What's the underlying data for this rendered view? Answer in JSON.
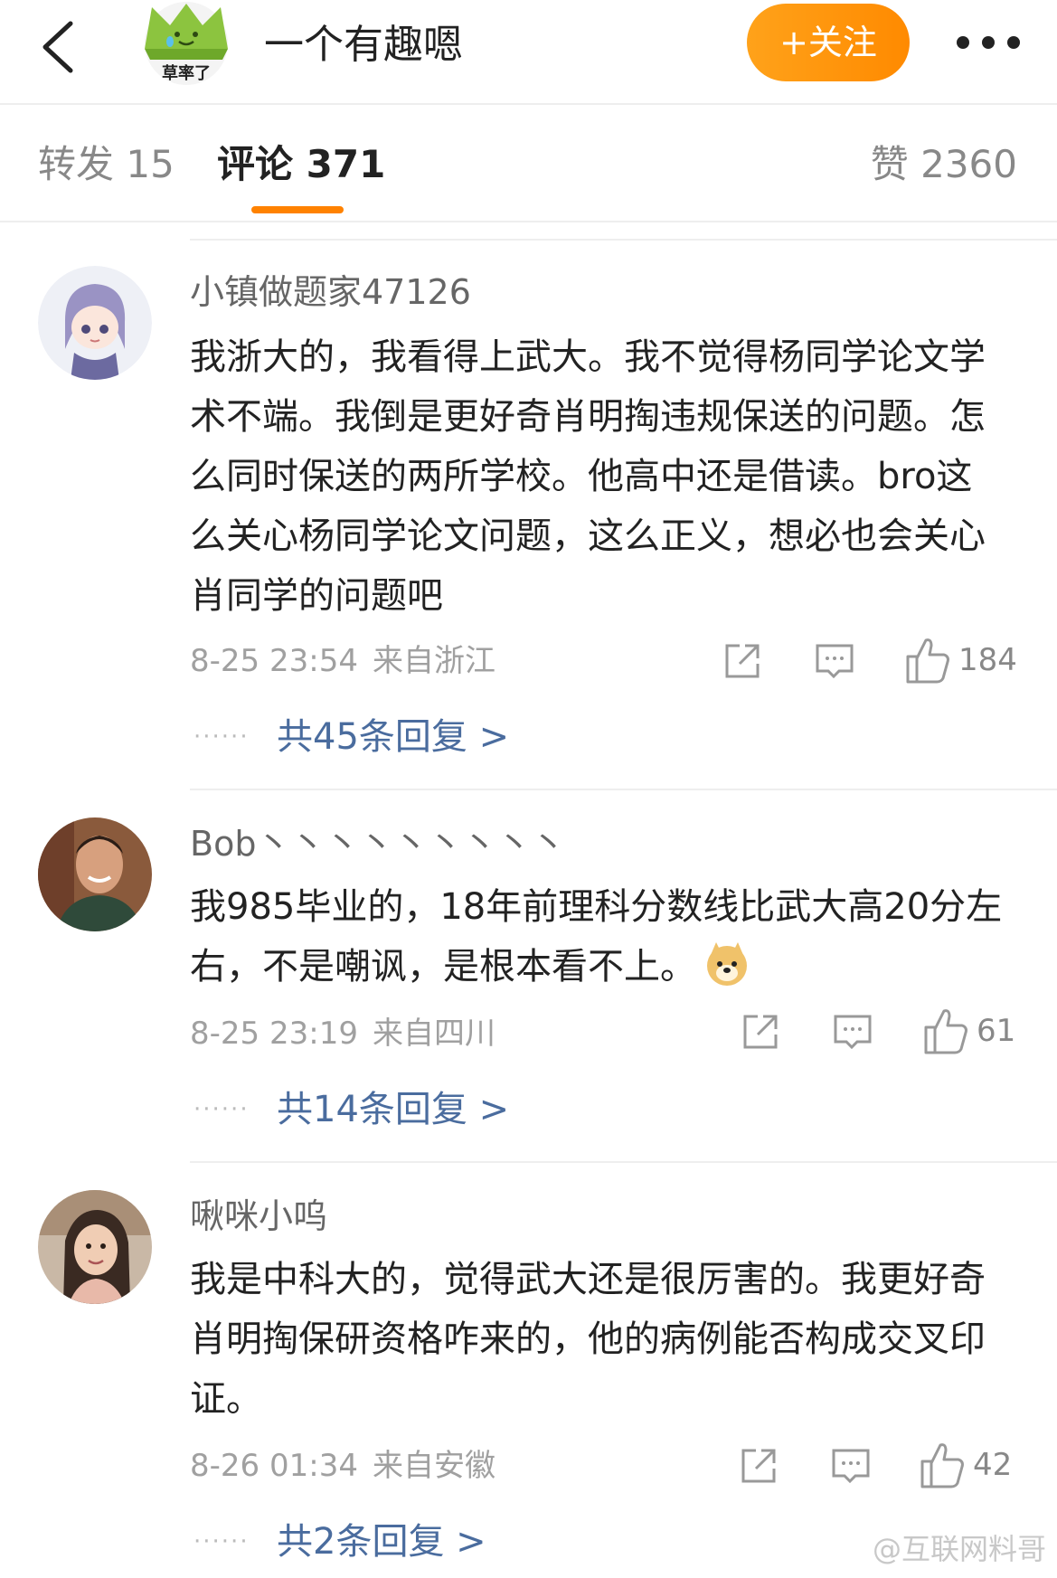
{
  "header": {
    "title": "一个有趣嗯",
    "avatar_caption": "草率了",
    "follow_label": "+关注"
  },
  "tabs": {
    "repost": "转发 15",
    "comments": "评论 371",
    "likes": "赞 2360"
  },
  "comments": [
    {
      "username": "小镇做题家47126",
      "content": "我浙大的，我看得上武大。我不觉得杨同学论文学术不端。我倒是更好奇肖明掏违规保送的问题。怎么同时保送的两所学校。他高中还是借读。bro这么关心杨同学论文问题，这么正义，想必也会关心肖同学的问题吧",
      "time": "8-25 23:54",
      "location": "来自浙江",
      "likes": "184",
      "replies": "共45条回复 >"
    },
    {
      "username": "Bob丶丶丶丶丶丶丶丶丶",
      "content": "我985毕业的，18年前理科分数线比武大高20分左右，不是嘲讽，是根本看不上。",
      "emoji": "doge",
      "time": "8-25 23:19",
      "location": "来自四川",
      "likes": "61",
      "replies": "共14条回复 >"
    },
    {
      "username": "啾咪小呜",
      "content": "我是中科大的，觉得武大还是很厉害的。我更好奇肖明掏保研资格咋来的，他的病例能否构成交叉印证。",
      "time": "8-26 01:34",
      "location": "来自安徽",
      "likes": "42",
      "replies": "共2条回复 >"
    }
  ],
  "reply_dots": "······",
  "watermark": "@互联网料哥",
  "colors": {
    "accent": "#ff8200",
    "link": "#4a6c9e",
    "muted": "#a0a0a0"
  },
  "icons": {
    "back": "chevron-left-icon",
    "more": "more-dots-icon",
    "share": "share-icon",
    "comment": "comment-icon",
    "like": "thumbs-up-icon"
  }
}
